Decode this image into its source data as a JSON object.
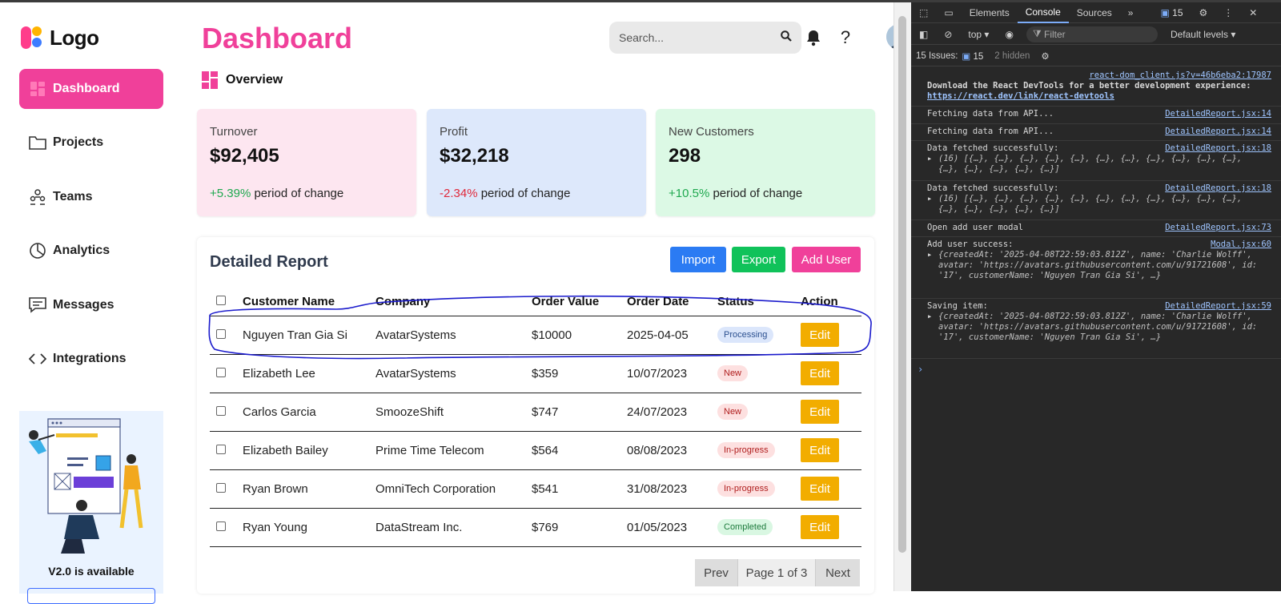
{
  "sidebar": {
    "logo": "Logo",
    "nav": [
      "Dashboard",
      "Projects",
      "Teams",
      "Analytics",
      "Messages",
      "Integrations"
    ],
    "promo_title": "V2.0 is available"
  },
  "header": {
    "title": "Dashboard",
    "search_placeholder": "Search...",
    "help": "?"
  },
  "overview": "Overview",
  "cards": [
    {
      "label": "Turnover",
      "value": "$92,405",
      "change": "+5.39%",
      "suffix": " period of change",
      "bg": "#fde6f0"
    },
    {
      "label": "Profit",
      "value": "$32,218",
      "change": "-2.34%",
      "suffix": " period of change",
      "bg": "#dde8fb"
    },
    {
      "label": "New Customers",
      "value": "298",
      "change": "+10.5%",
      "suffix": " period of change",
      "bg": "#dcf9e5"
    }
  ],
  "report": {
    "title": "Detailed Report",
    "buttons": {
      "import": "Import",
      "export": "Export",
      "add_user": "Add User"
    },
    "columns": [
      "Customer Name",
      "Company",
      "Order Value",
      "Order Date",
      "Status",
      "Action"
    ],
    "rows": [
      {
        "name": "Nguyen Tran Gia Si",
        "company": "AvatarSystems",
        "value": "$10000",
        "date": "2025-04-05",
        "status": "Processing",
        "action": "Edit"
      },
      {
        "name": "Elizabeth Lee",
        "company": "AvatarSystems",
        "value": "$359",
        "date": "10/07/2023",
        "status": "New",
        "action": "Edit"
      },
      {
        "name": "Carlos Garcia",
        "company": "SmoozeShift",
        "value": "$747",
        "date": "24/07/2023",
        "status": "New",
        "action": "Edit"
      },
      {
        "name": "Elizabeth Bailey",
        "company": "Prime Time Telecom",
        "value": "$564",
        "date": "08/08/2023",
        "status": "In-progress",
        "action": "Edit"
      },
      {
        "name": "Ryan Brown",
        "company": "OmniTech Corporation",
        "value": "$541",
        "date": "31/08/2023",
        "status": "In-progress",
        "action": "Edit"
      },
      {
        "name": "Ryan Young",
        "company": "DataStream Inc.",
        "value": "$769",
        "date": "01/05/2023",
        "status": "Completed",
        "action": "Edit"
      }
    ],
    "pager": {
      "prev": "Prev",
      "page": "Page 1 of 3",
      "next": "Next"
    }
  },
  "status_colors": {
    "Processing": {
      "bg": "#dbe6fb",
      "fg": "#2a4f8f"
    },
    "New": {
      "bg": "#fde0e0",
      "fg": "#b01e1e"
    },
    "In-progress": {
      "bg": "#fde0e0",
      "fg": "#b01e1e"
    },
    "Completed": {
      "bg": "#d9f7e2",
      "fg": "#1d7a3c"
    }
  },
  "devtools": {
    "tabs": [
      "Elements",
      "Console",
      "Sources"
    ],
    "issues_badge": "15",
    "context": "top",
    "filter_placeholder": "Filter",
    "levels": "Default levels",
    "issues_label": "15 Issues:",
    "issues_count": "15",
    "hidden": "2 hidden",
    "messages": [
      {
        "source": "react-dom_client.js?v=46b6eba2:17987",
        "text": "Download the React DevTools for a better development experience: ",
        "link": "https://react.dev/link/react-devtools"
      },
      {
        "source": "DetailedReport.jsx:14",
        "text": "Fetching data from API..."
      },
      {
        "source": "DetailedReport.jsx:14",
        "text": "Fetching data from API..."
      },
      {
        "source": "DetailedReport.jsx:18",
        "text": "Data fetched successfully:",
        "detail": "(16) [{…}, {…}, {…}, {…}, {…}, {…}, {…}, {…}, {…}, {…}, {…}, {…}, {…}, {…}, {…}, {…}]"
      },
      {
        "source": "DetailedReport.jsx:18",
        "text": "Data fetched successfully:",
        "detail": "(16) [{…}, {…}, {…}, {…}, {…}, {…}, {…}, {…}, {…}, {…}, {…}, {…}, {…}, {…}, {…}, {…}]"
      },
      {
        "source": "DetailedReport.jsx:73",
        "text": "Open add user modal"
      },
      {
        "source": "Modal.jsx:60",
        "text": "Add user success:",
        "detail": "{createdAt: '2025-04-08T22:59:03.812Z', name: 'Charlie Wolff', avatar: 'https://avatars.githubusercontent.com/u/91721608', id: '17', customerName: 'Nguyen Tran Gia Si', …}"
      },
      {
        "source": "DetailedReport.jsx:59",
        "text": "Saving item:",
        "detail": "{createdAt: '2025-04-08T22:59:03.812Z', name: 'Charlie Wolff', avatar: 'https://avatars.githubusercontent.com/u/91721608', id: '17', customerName: 'Nguyen Tran Gia Si', …}"
      }
    ]
  }
}
